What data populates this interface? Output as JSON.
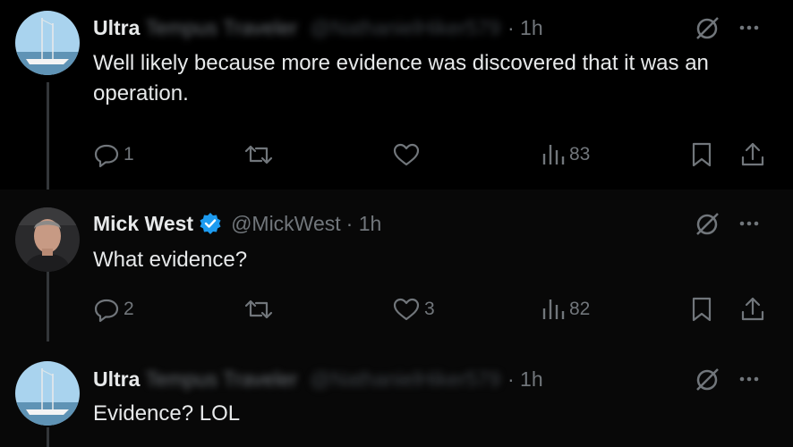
{
  "tweets": [
    {
      "name": "Ultra",
      "blurred_name": "Tempus Traveler",
      "blurred_handle": "@NathanielHiker579",
      "time": "· 1h",
      "text": "Well likely because more evidence was discovered that it was an operation.",
      "replies": "1",
      "reposts": "",
      "likes": "",
      "views": "83"
    },
    {
      "name": "Mick West",
      "handle": "@MickWest",
      "time": "· 1h",
      "text": "What evidence?",
      "replies": "2",
      "reposts": "",
      "likes": "3",
      "views": "82"
    },
    {
      "name": "Ultra",
      "blurred_name": "Tempus Traveler",
      "blurred_handle": "@NathanielHiker579",
      "time": "· 1h",
      "text": "Evidence? LOL"
    }
  ],
  "colors": {
    "background": "#000000",
    "text": "#e7e9ea",
    "muted": "#71767b",
    "verified": "#1d9bf0"
  },
  "icons": [
    "reply-icon",
    "repost-icon",
    "like-icon",
    "views-icon",
    "bookmark-icon",
    "share-icon",
    "grok-icon",
    "more-icon",
    "verified-badge-icon"
  ]
}
